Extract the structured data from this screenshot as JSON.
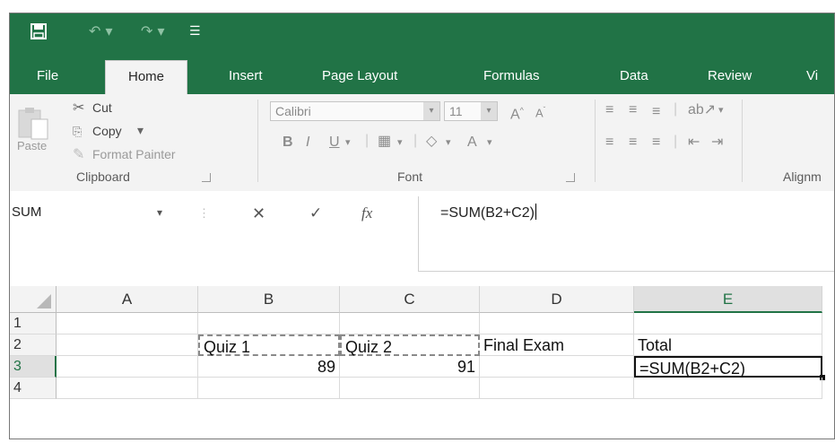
{
  "quick_access": {
    "save_icon": "save-icon",
    "undo_icon": "undo-icon",
    "redo_icon": "redo-icon",
    "customize_icon": "customize-icon"
  },
  "tabs": [
    {
      "label": "File"
    },
    {
      "label": "Home",
      "active": true
    },
    {
      "label": "Insert"
    },
    {
      "label": "Page Layout"
    },
    {
      "label": "Formulas"
    },
    {
      "label": "Data"
    },
    {
      "label": "Review"
    },
    {
      "label": "Vi"
    }
  ],
  "ribbon": {
    "clipboard": {
      "paste": "Paste",
      "cut": "Cut",
      "copy": "Copy",
      "format_painter": "Format Painter",
      "group_label": "Clipboard"
    },
    "font": {
      "font_name": "Calibri",
      "font_size": "11",
      "bold": "B",
      "italic": "I",
      "underline": "U",
      "font_color": "A",
      "group_label": "Font"
    },
    "alignment": {
      "group_label": "Alignm"
    }
  },
  "formula_bar": {
    "name_box": "SUM",
    "cancel_icon": "close-icon",
    "enter_icon": "check-icon",
    "fx_label": "fx",
    "formula": "=SUM(B2+C2)"
  },
  "grid": {
    "columns": [
      "A",
      "B",
      "C",
      "D",
      "E"
    ],
    "rows": [
      "1",
      "2",
      "3",
      "4"
    ],
    "cells": {
      "B2": "Quiz 1",
      "C2": "Quiz 2",
      "D2": "Final Exam",
      "E2": "Total",
      "B3": "89",
      "C3": "91",
      "E3": "=SUM(B2+C2)"
    },
    "active_cell": "E3"
  },
  "colors": {
    "accent": "#217346",
    "ribbon_bg": "#f3f3f3",
    "header_bg": "#f3f3f3"
  }
}
